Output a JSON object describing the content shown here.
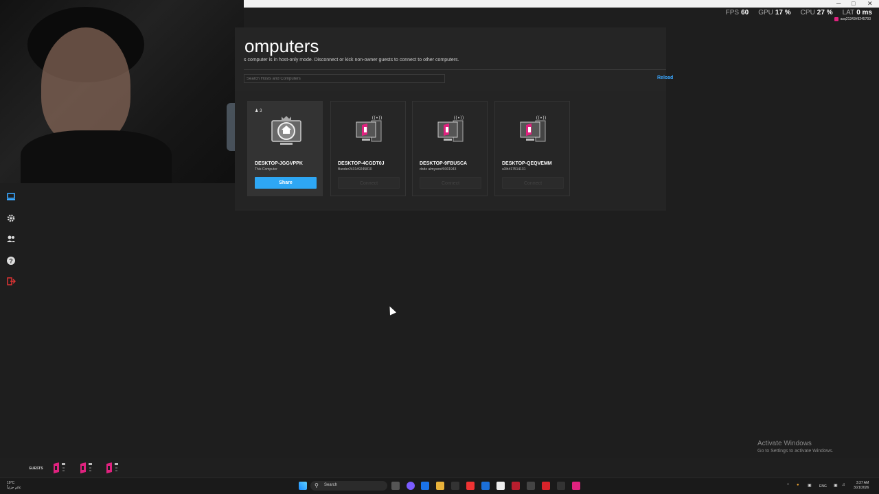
{
  "window": {
    "minimize": "─",
    "maximize": "□",
    "close": "✕"
  },
  "stats": {
    "fps_label": "FPS",
    "fps": "60",
    "gpu_label": "GPU",
    "gpu": "17 %",
    "cpu_label": "CPU",
    "cpu": "27 %",
    "lat_label": "LAT",
    "lat": "0 ms"
  },
  "user": {
    "name": "asq21343#9245793"
  },
  "page": {
    "title": "omputers",
    "subtitle": "s computer is in host-only mode. Disconnect or kick non-owner guests to connect to other computers.",
    "search_placeholder": "Search Hosts and Computers",
    "reload": "Reload"
  },
  "computers": [
    {
      "name": "DESKTOP-JGGVPPK",
      "owner": "This Computer",
      "guests": "3",
      "button": "Share"
    },
    {
      "name": "DESKTOP-4CGDT0J",
      "owner": "Bunder2431#9245810",
      "button": "Connect"
    },
    {
      "name": "DESKTOP-9FBUSCA",
      "owner": "dode almyson#9301943",
      "button": "Connect"
    },
    {
      "name": "DESKTOP-QEQVEMM",
      "owner": "u3lh#17514131",
      "button": "Connect"
    }
  ],
  "activate": {
    "line1": "Activate Windows",
    "line2": "Go to Settings to activate Windows."
  },
  "guests_label": "GUESTS",
  "taskbar": {
    "weather_temp": "19°C",
    "weather_desc": "غائم جزئياً",
    "search": "Search",
    "lang": "ENG",
    "time": "3:37 AM",
    "date": "3/21/2026"
  },
  "colors": {
    "accent": "#2ea7f4",
    "brand": "#e0227f"
  }
}
